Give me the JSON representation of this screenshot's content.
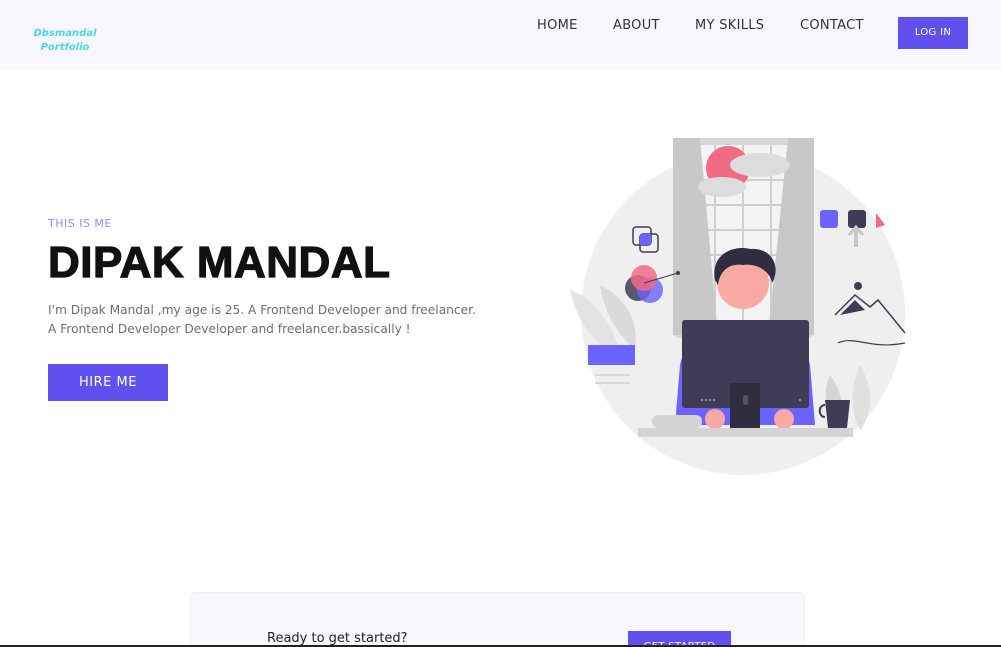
{
  "header": {
    "logo_line1": "Dbsmandal",
    "logo_line2": "Portfolio",
    "nav": [
      "HOME",
      "ABOUT",
      "MY SKILLS",
      "CONTACT"
    ],
    "login_label": "LOG IN"
  },
  "hero": {
    "eyebrow": "THIS IS ME",
    "title": "DIPAK MANDAL",
    "desc_line1": "I'm Dipak Mandal ,my age is 25. A Frontend Developer and freelancer.",
    "desc_line2": "A Frontend Developer Developer and freelancer.bassically !",
    "hire_label": "HIRE ME"
  },
  "cta": {
    "text": "Ready to get started?",
    "button_label": "GET STARTED"
  },
  "colors": {
    "accent": "#6050f0",
    "logo": "#4dd6e8",
    "header_bg": "#f8f7fd",
    "eyebrow": "#8c8ff5",
    "pink": "#f26b84"
  },
  "icons": [
    "developer-at-desk-illustration"
  ]
}
